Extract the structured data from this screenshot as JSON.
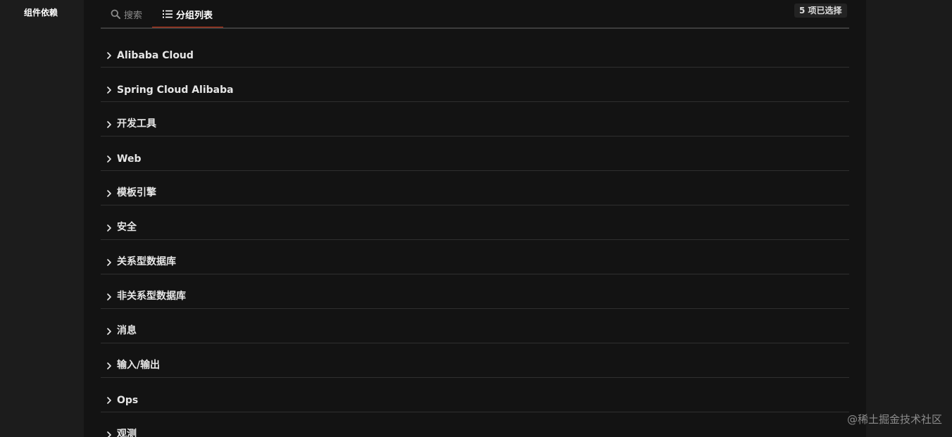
{
  "sidebar": {
    "title": "组件依赖"
  },
  "tabs": [
    {
      "label": "搜索",
      "icon": "search-icon",
      "active": false
    },
    {
      "label": "分组列表",
      "icon": "list-icon",
      "active": true
    }
  ],
  "selection_badge": "5 项已选择",
  "groups": [
    {
      "label": "Alibaba Cloud"
    },
    {
      "label": "Spring Cloud Alibaba"
    },
    {
      "label": "开发工具"
    },
    {
      "label": "Web"
    },
    {
      "label": "模板引擎"
    },
    {
      "label": "安全"
    },
    {
      "label": "关系型数据库"
    },
    {
      "label": "非关系型数据库"
    },
    {
      "label": "消息"
    },
    {
      "label": "输入/输出"
    },
    {
      "label": "Ops"
    },
    {
      "label": "观测"
    }
  ],
  "watermark": "@稀土掘金技术社区",
  "colors": {
    "accent": "#d93a1b",
    "panel_background": "#131313",
    "text": "#e6e6e6"
  }
}
